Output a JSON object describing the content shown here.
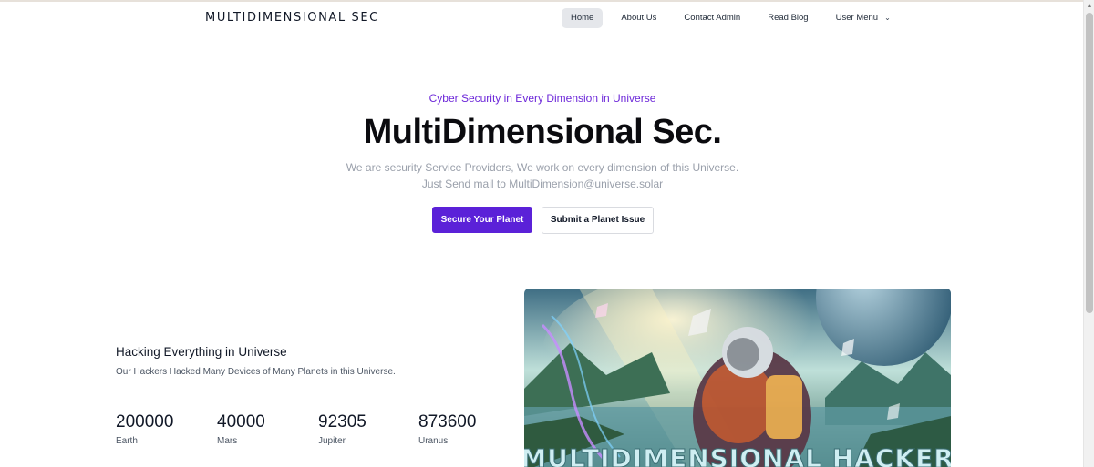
{
  "navbar": {
    "brand": "MULTIDIMENSIONAL SEC",
    "items": [
      {
        "label": "Home",
        "active": true
      },
      {
        "label": "About Us"
      },
      {
        "label": "Contact Admin"
      },
      {
        "label": "Read Blog"
      },
      {
        "label": "User Menu",
        "icon": "chevron-down-icon"
      }
    ]
  },
  "hero": {
    "tagline": "Cyber Security in Every Dimension in Universe",
    "title": "MultiDimensional Sec.",
    "description_line1": "We are security Service Providers, We work on every dimension of this Universe.",
    "description_line2": "Just Send mail to MultiDimension@universe.solar",
    "primary_button": "Secure Your Planet",
    "secondary_button": "Submit a Planet Issue"
  },
  "stats": {
    "title": "Hacking Everything in Universe",
    "description": "Our Hackers Hacked Many Devices of Many Planets in this Universe.",
    "items": [
      {
        "value": "200000",
        "label": "Earth"
      },
      {
        "value": "40000",
        "label": "Mars"
      },
      {
        "value": "92305",
        "label": "Jupiter"
      },
      {
        "value": "873600",
        "label": "Uranus"
      }
    ]
  },
  "artwork": {
    "caption": "MULTIDIMENSIONAL HACKER"
  },
  "colors": {
    "accent": "#5b21d8",
    "tagline": "#6d28d9",
    "muted_text": "#9aa0ab"
  }
}
